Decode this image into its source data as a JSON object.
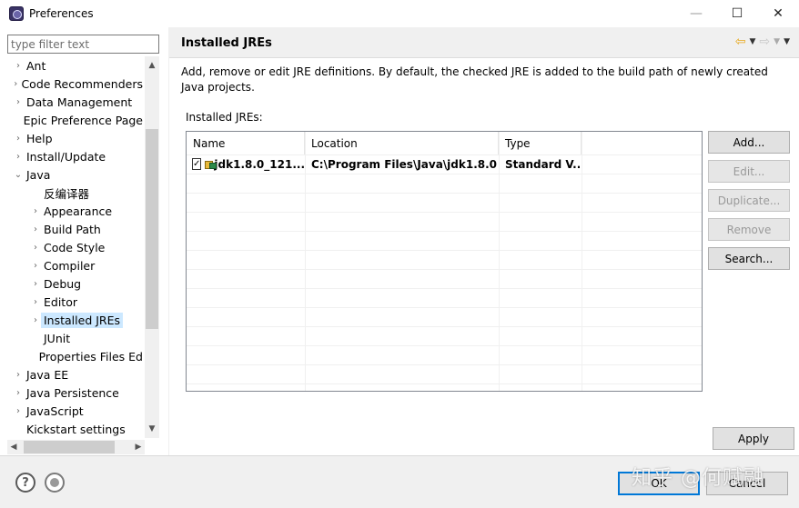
{
  "window": {
    "title": "Preferences",
    "minimize_glyph": "—",
    "maximize_glyph": "☐",
    "close_glyph": "✕"
  },
  "filter": {
    "placeholder": "type filter text"
  },
  "tree": {
    "items": [
      {
        "label": "Ant",
        "arrow": "›",
        "level": 0
      },
      {
        "label": "Code Recommenders",
        "arrow": "›",
        "level": 0
      },
      {
        "label": "Data Management",
        "arrow": "›",
        "level": 0
      },
      {
        "label": "Epic Preference Page",
        "arrow": "",
        "level": 0
      },
      {
        "label": "Help",
        "arrow": "›",
        "level": 0
      },
      {
        "label": "Install/Update",
        "arrow": "›",
        "level": 0
      },
      {
        "label": "Java",
        "arrow": "⌄",
        "level": 0
      },
      {
        "label": "反编译器",
        "arrow": "",
        "level": 1
      },
      {
        "label": "Appearance",
        "arrow": "›",
        "level": 1
      },
      {
        "label": "Build Path",
        "arrow": "›",
        "level": 1
      },
      {
        "label": "Code Style",
        "arrow": "›",
        "level": 1
      },
      {
        "label": "Compiler",
        "arrow": "›",
        "level": 1
      },
      {
        "label": "Debug",
        "arrow": "›",
        "level": 1
      },
      {
        "label": "Editor",
        "arrow": "›",
        "level": 1
      },
      {
        "label": "Installed JREs",
        "arrow": "›",
        "level": 1,
        "selected": true
      },
      {
        "label": "JUnit",
        "arrow": "",
        "level": 1
      },
      {
        "label": "Properties Files Ed",
        "arrow": "",
        "level": 1
      },
      {
        "label": "Java EE",
        "arrow": "›",
        "level": 0
      },
      {
        "label": "Java Persistence",
        "arrow": "›",
        "level": 0
      },
      {
        "label": "JavaScript",
        "arrow": "›",
        "level": 0
      },
      {
        "label": "Kickstart settings",
        "arrow": "",
        "level": 0
      }
    ]
  },
  "page": {
    "title": "Installed JREs",
    "description": "Add, remove or edit JRE definitions. By default, the checked JRE is added to the build path of newly created Java projects.",
    "section_label": "Installed JREs:"
  },
  "table": {
    "columns": [
      "Name",
      "Location",
      "Type"
    ],
    "rows": [
      {
        "checked": true,
        "name": "jdk1.8.0_121...",
        "location": "C:\\Program Files\\Java\\jdk1.8.0...",
        "type": "Standard V..."
      }
    ]
  },
  "buttons": {
    "add": "Add...",
    "edit": "Edit...",
    "duplicate": "Duplicate...",
    "remove": "Remove",
    "search": "Search...",
    "apply": "Apply",
    "ok": "OK",
    "cancel": "Cancel"
  },
  "icons": {
    "back": "⇦",
    "forward": "⇨",
    "dropdown": "▼",
    "help": "?"
  },
  "watermark": "知乎 @何赋融"
}
